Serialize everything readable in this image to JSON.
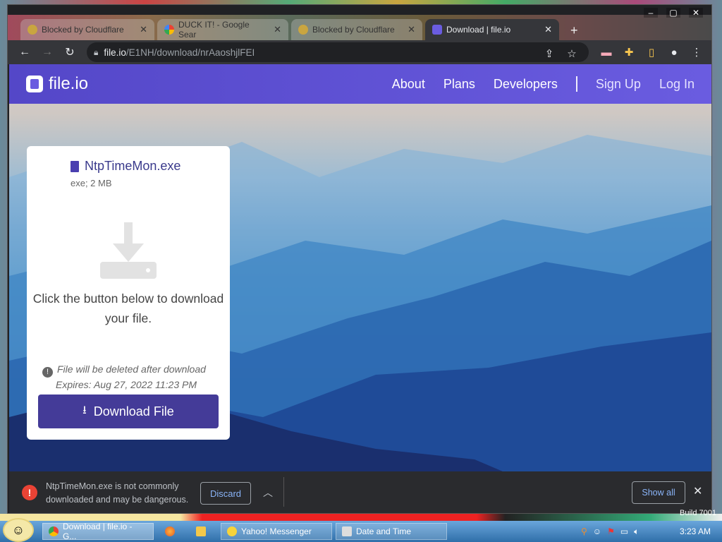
{
  "browser": {
    "tabs": [
      {
        "title": "Blocked by Cloudflare",
        "active": false
      },
      {
        "title": "DUCK IT! - Google Sear",
        "active": false
      },
      {
        "title": "Blocked by Cloudflare",
        "active": false
      },
      {
        "title": "Download | file.io",
        "active": true
      }
    ],
    "new_tab_label": "+",
    "address": {
      "host": "file.io",
      "path": "/E1NH/download/nrAaoshjlFEI"
    },
    "window_controls": {
      "minimize": "‒",
      "maximize": "▢",
      "close": "✕"
    }
  },
  "site": {
    "logo_text": "file.io",
    "nav": [
      "About",
      "Plans",
      "Developers"
    ],
    "auth": [
      "Sign Up",
      "Log In"
    ],
    "file": {
      "name": "NtpTimeMon.exe",
      "meta": "exe; 2 MB"
    },
    "message": "Click the button below to download your file.",
    "warning_line1": "File will be deleted after download",
    "warning_line2": "Expires: Aug 27, 2022 11:23 PM",
    "download_button": "Download File"
  },
  "download_bar": {
    "text": "NtpTimeMon.exe is not commonly downloaded and may be dangerous.",
    "discard": "Discard",
    "show_all": "Show all"
  },
  "taskbar": {
    "items": [
      {
        "label": "Download | file.io - G...",
        "active": true
      },
      {
        "label": "",
        "active": false
      },
      {
        "label": "",
        "active": false
      },
      {
        "label": "Yahoo! Messenger",
        "active": false
      },
      {
        "label": "Date and Time",
        "active": false
      }
    ],
    "clock": "3:23 AM",
    "build": "Build 7001"
  },
  "colors": {
    "brand": "#5447c8",
    "button": "#443b98",
    "danger": "#ea4335",
    "link": "#8ab4f8"
  }
}
